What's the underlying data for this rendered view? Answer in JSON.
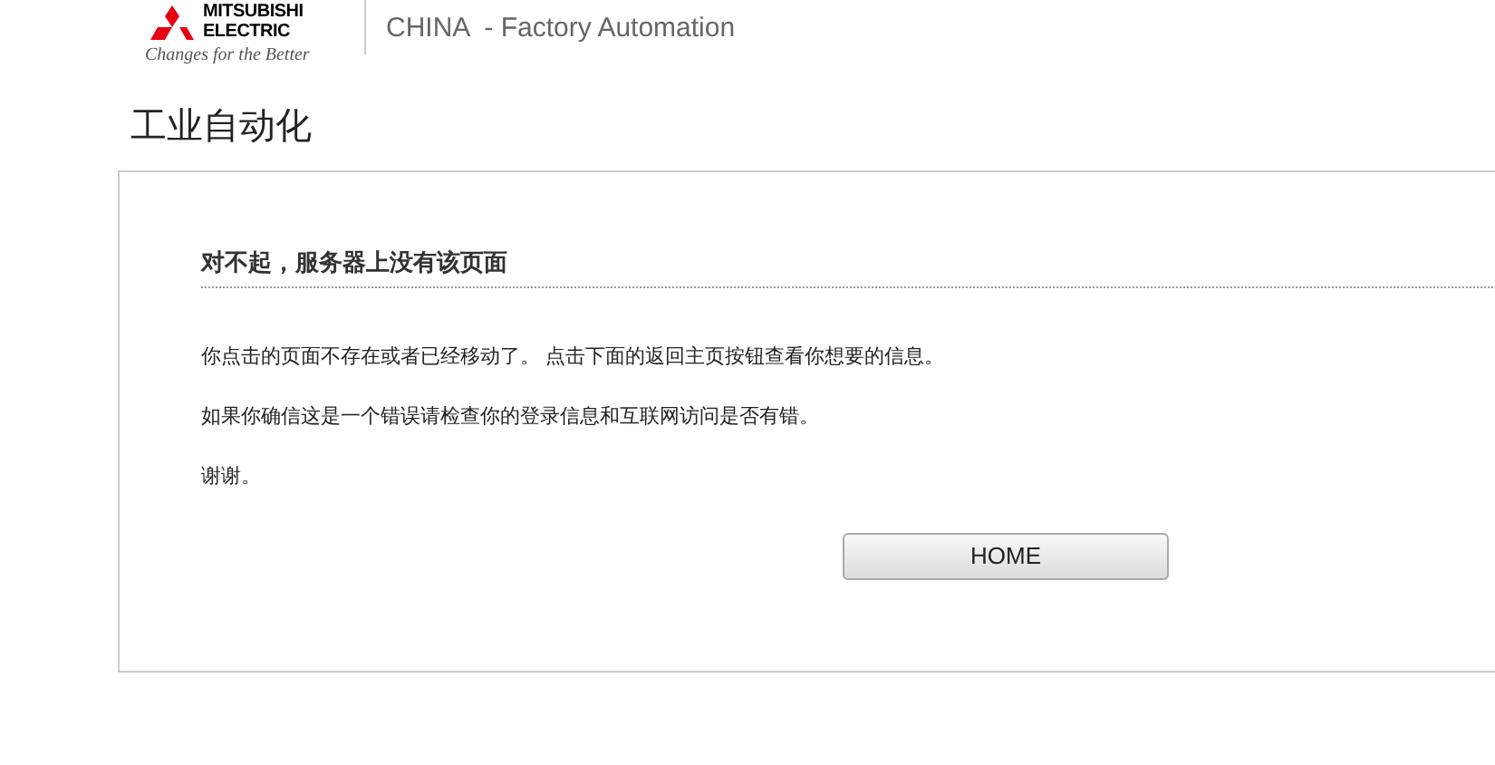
{
  "header": {
    "logo_lines": [
      "MITSUBISHI",
      "ELECTRIC"
    ],
    "slogan": "Changes for the Better",
    "site_title": "CHINA  - Factory Automation"
  },
  "page_title": "工业自动化",
  "error": {
    "heading": "对不起，服务器上没有该页面",
    "paragraphs": [
      "你点击的页面不存在或者已经移动了。 点击下面的返回主页按钮查看你想要的信息。",
      "如果你确信这是一个错误请检查你的登录信息和互联网访问是否有错。",
      "谢谢。"
    ],
    "button": "HOME"
  }
}
